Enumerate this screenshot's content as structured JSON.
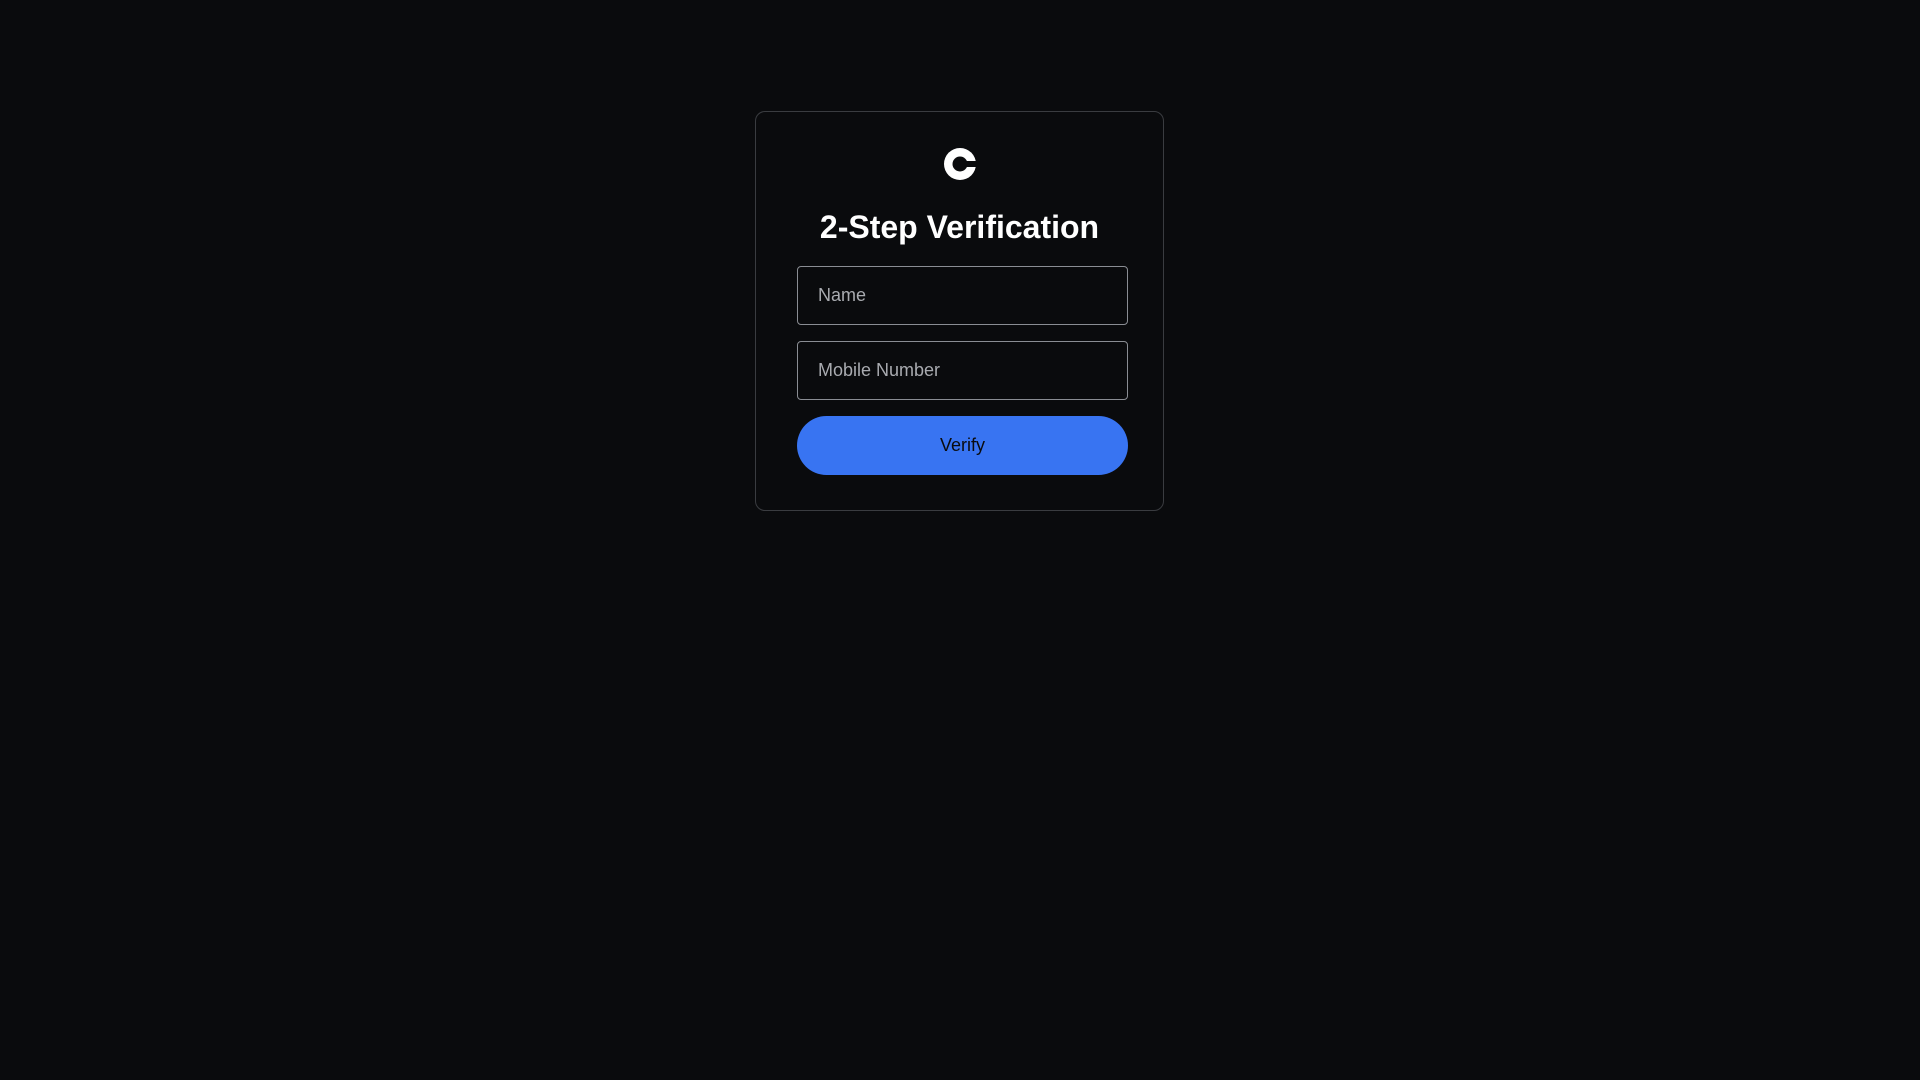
{
  "logo": {
    "icon": "coinbase-c-logo-icon",
    "color": "#ffffff"
  },
  "title": "2-Step Verification",
  "form": {
    "name_placeholder": "Name",
    "name_value": "",
    "mobile_placeholder": "Mobile Number",
    "mobile_value": "",
    "verify_label": "Verify"
  },
  "colors": {
    "background": "#0a0b0d",
    "accent": "#3874f2",
    "card_border": "#3a3c40"
  }
}
